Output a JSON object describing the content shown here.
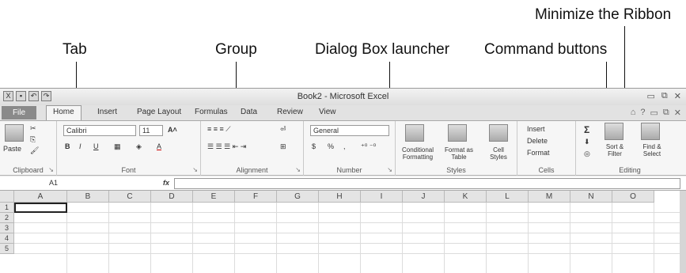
{
  "annotations": {
    "minimize_ribbon": "Minimize the Ribbon",
    "tab": "Tab",
    "group": "Group",
    "dialog_box_launcher": "Dialog Box launcher",
    "command_buttons": "Command buttons"
  },
  "window": {
    "title": "Book2 - Microsoft Excel",
    "controls": [
      "▭",
      "⧉",
      "✕"
    ]
  },
  "tabs": {
    "file": "File",
    "items": [
      "Home",
      "Insert",
      "Page Layout",
      "Formulas",
      "Data",
      "Review",
      "View"
    ]
  },
  "ribbon_controls": [
    "⌂",
    "?",
    "▭",
    "⧉",
    "✕"
  ],
  "groups": {
    "clipboard": {
      "label": "Clipboard",
      "paste": "Paste"
    },
    "font": {
      "label": "Font",
      "name": "Calibri",
      "size": "11",
      "bold": "B",
      "italic": "I",
      "underline": "U"
    },
    "alignment": {
      "label": "Alignment"
    },
    "number": {
      "label": "Number",
      "format": "General",
      "currency": "$",
      "percent": "%",
      "comma": ","
    },
    "styles": {
      "label": "Styles",
      "conditional": "Conditional Formatting",
      "table": "Format as Table",
      "cell": "Cell Styles"
    },
    "cells": {
      "label": "Cells",
      "insert": "Insert",
      "delete": "Delete",
      "format": "Format"
    },
    "editing": {
      "label": "Editing",
      "sum": "Σ",
      "sort": "Sort & Filter",
      "find": "Find & Select"
    }
  },
  "formula_bar": {
    "name_box": "A1",
    "fx": "fx"
  },
  "grid": {
    "columns": [
      "A",
      "B",
      "C",
      "D",
      "E",
      "F",
      "G",
      "H",
      "I",
      "J",
      "K",
      "L",
      "M",
      "N",
      "O"
    ],
    "rows": [
      "1",
      "2",
      "3",
      "4",
      "5"
    ]
  }
}
